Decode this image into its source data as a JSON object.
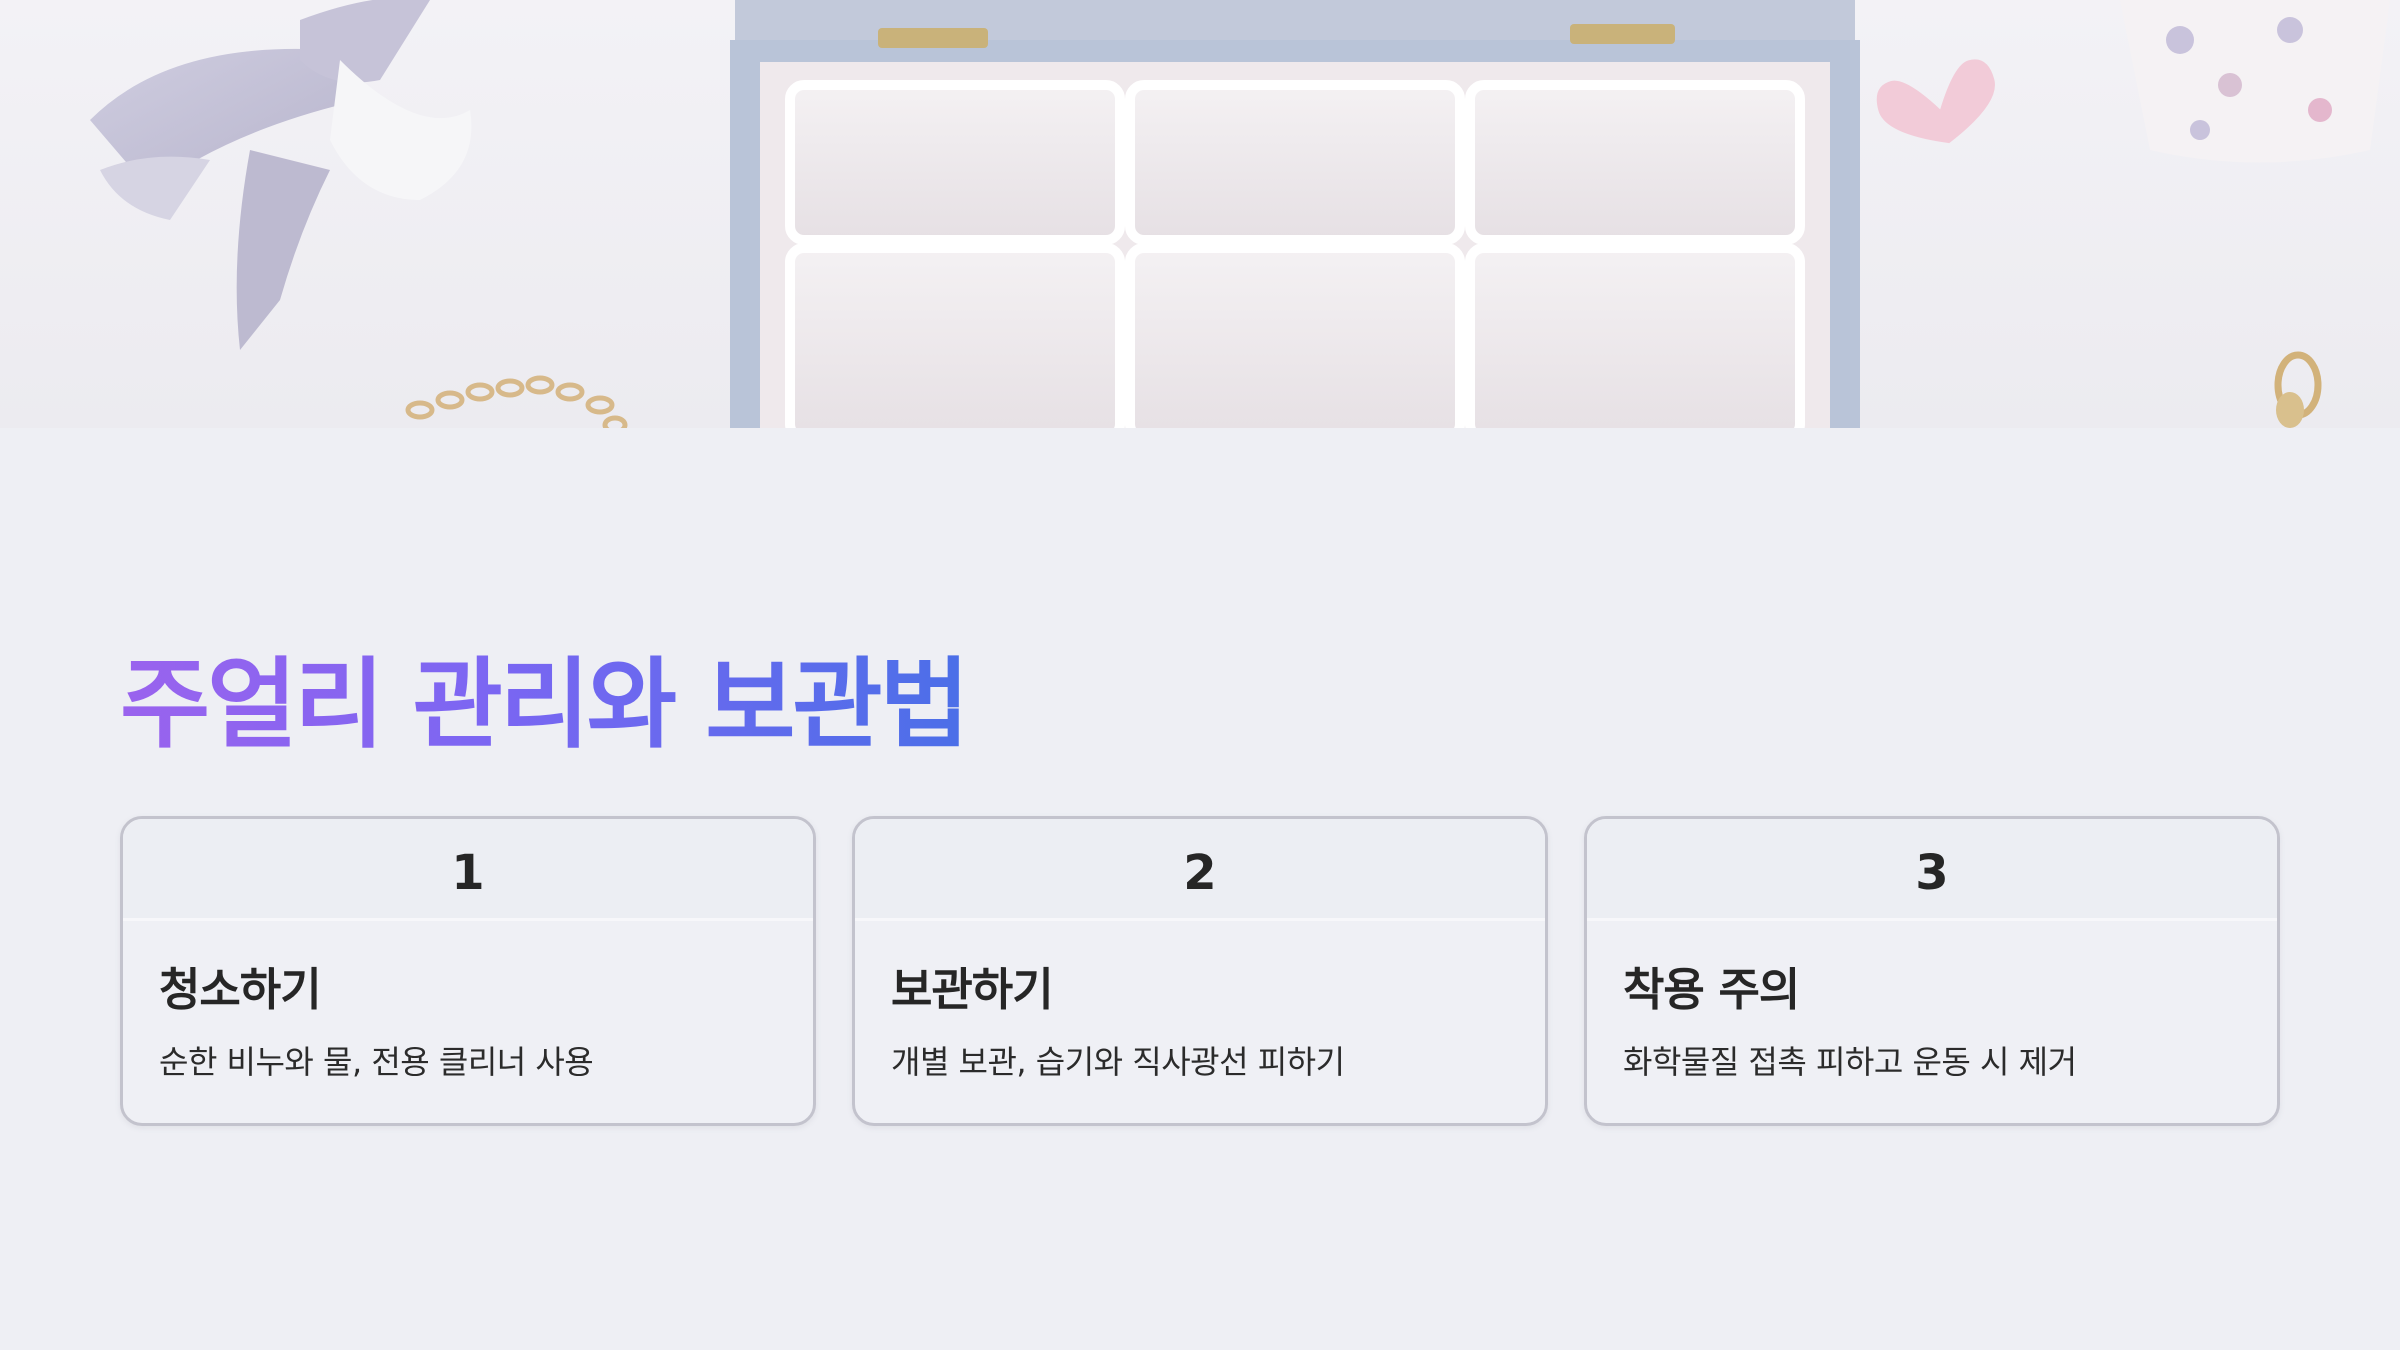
{
  "hero": {
    "image": "jewelry-box-photo"
  },
  "title": "주얼리 관리와 보관법",
  "cards": [
    {
      "number": "1",
      "title": "청소하기",
      "description": "순한 비누와 물, 전용 클리너 사용"
    },
    {
      "number": "2",
      "title": "보관하기",
      "description": "개별 보관, 습기와 직사광선 피하기"
    },
    {
      "number": "3",
      "title": "착용 주의",
      "description": "화학물질 접촉 피하고 운동 시 제거"
    }
  ],
  "colors": {
    "background": "#eeeff4",
    "title_gradient_start": "#9a63ee",
    "title_gradient_end": "#4b6fe8",
    "card_border": "#c3c3cd",
    "text_dark": "#262626"
  }
}
